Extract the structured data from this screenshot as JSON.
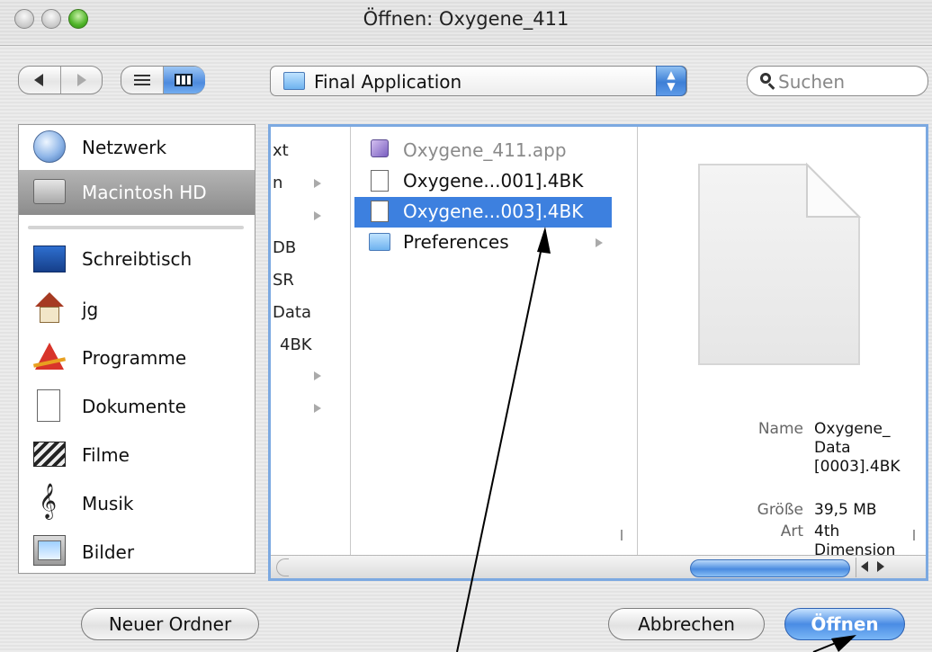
{
  "window": {
    "title": "Öffnen: Oxygene_411"
  },
  "toolbar": {
    "location": "Final Application",
    "search_placeholder": "Suchen",
    "view_modes": [
      "list",
      "columns"
    ]
  },
  "sidebar": {
    "devices": [
      {
        "label": "Netzwerk",
        "icon": "network-globe-icon"
      },
      {
        "label": "Macintosh HD",
        "icon": "hard-disk-icon",
        "selected": true
      }
    ],
    "places": [
      {
        "label": "Schreibtisch",
        "icon": "desktop-icon"
      },
      {
        "label": "jg",
        "icon": "home-icon"
      },
      {
        "label": "Programme",
        "icon": "applications-icon"
      },
      {
        "label": "Dokumente",
        "icon": "documents-icon"
      },
      {
        "label": "Filme",
        "icon": "movies-icon"
      },
      {
        "label": "Musik",
        "icon": "music-icon"
      },
      {
        "label": "Bilder",
        "icon": "pictures-icon"
      }
    ]
  },
  "browser": {
    "prev_column_fragments": [
      "xt",
      "n",
      "DB",
      "SR",
      "Data",
      "4BK"
    ],
    "files": [
      {
        "name": "Oxygene_411.app",
        "kind": "app",
        "disabled": true
      },
      {
        "name": "Oxygene...001].4BK",
        "kind": "document"
      },
      {
        "name": "Oxygene...003].4BK",
        "kind": "document",
        "selected": true
      },
      {
        "name": "Preferences",
        "kind": "folder"
      }
    ],
    "preview": {
      "name_label": "Name",
      "name_lines": [
        "Oxygene_",
        "Data",
        "[0003].4BK"
      ],
      "size_label": "Größe",
      "size_value": "39,5 MB",
      "kind_label": "Art",
      "kind_lines": [
        "4th",
        "Dimension"
      ]
    }
  },
  "buttons": {
    "new_folder": "Neuer Ordner",
    "cancel": "Abbrechen",
    "open": "Öffnen"
  },
  "colors": {
    "accent": "#3d80df",
    "focus_ring": "#7ca9e1"
  }
}
